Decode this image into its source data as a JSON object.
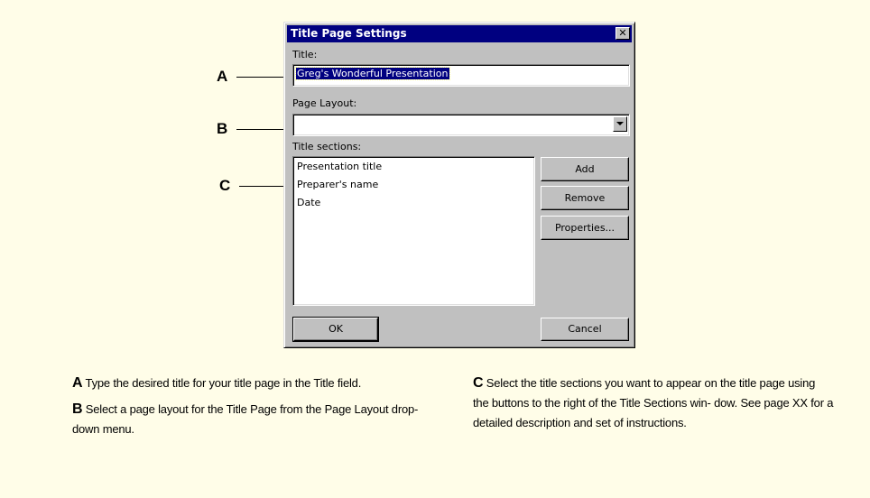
{
  "dialog": {
    "title": "Title Page Settings",
    "close_glyph": "✕",
    "title_label": "Title:",
    "title_value": "Greg's Wonderful Presentation",
    "page_layout_label": "Page Layout:",
    "page_layout_value": "",
    "sections_label": "Title sections:",
    "sections": [
      "Presentation title",
      "Preparer's name",
      "Date"
    ],
    "buttons": {
      "add": "Add",
      "remove": "Remove",
      "properties": "Properties...",
      "ok": "OK",
      "cancel": "Cancel"
    }
  },
  "callouts": [
    "A",
    "B",
    "C"
  ],
  "captions": {
    "a_letter": "A",
    "a_text": "Type the desired title for your title page in the Title field.",
    "b_letter": "B",
    "b_text": "Select a page layout for the Title Page from the Page Layout drop-down menu.",
    "c_letter": "C",
    "c_text": "Select the title sections you want to appear on the title page using the buttons to the right of the Title Sections win- dow. See page XX for a detailed description and set of instructions."
  },
  "colors": {
    "page_background": "#fffde8",
    "dialog_face": "#c0c0c0",
    "titlebar": "#000080",
    "selection": "#000080"
  },
  "icons": [
    "close-icon",
    "dropdown-arrow-icon"
  ]
}
